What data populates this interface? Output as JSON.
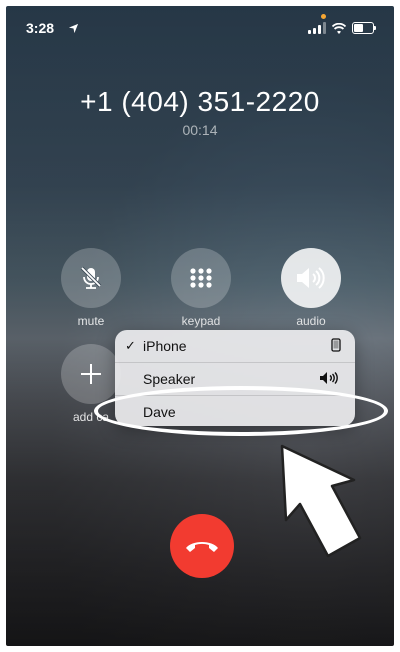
{
  "status_bar": {
    "time": "3:28",
    "location_icon": "location-arrow-icon",
    "signal_icon": "signal-bars-icon",
    "wifi_icon": "wifi-icon",
    "battery_icon": "battery-icon"
  },
  "call": {
    "number": "+1 (404) 351-2220",
    "duration": "00:14"
  },
  "controls": [
    {
      "label": "mute",
      "icon": "mute-mic-icon"
    },
    {
      "label": "keypad",
      "icon": "keypad-icon"
    },
    {
      "label": "audio",
      "icon": "speaker-icon",
      "active": true
    },
    {
      "label": "add ca",
      "icon": "plus-icon"
    }
  ],
  "audio_menu": {
    "items": [
      {
        "label": "iPhone",
        "checked": true,
        "icon": "iphone-icon"
      },
      {
        "label": "Speaker",
        "checked": false,
        "icon": "speaker-icon"
      },
      {
        "label": "Dave",
        "checked": false,
        "icon": ""
      }
    ]
  },
  "end_call": {
    "icon": "end-call-icon"
  },
  "annotation": {
    "highlight": "ellipse",
    "pointer": "arrow"
  },
  "colors": {
    "end_call": "#f23b30",
    "menu_bg": "#ebebed",
    "status_dot": "#f7a733"
  }
}
